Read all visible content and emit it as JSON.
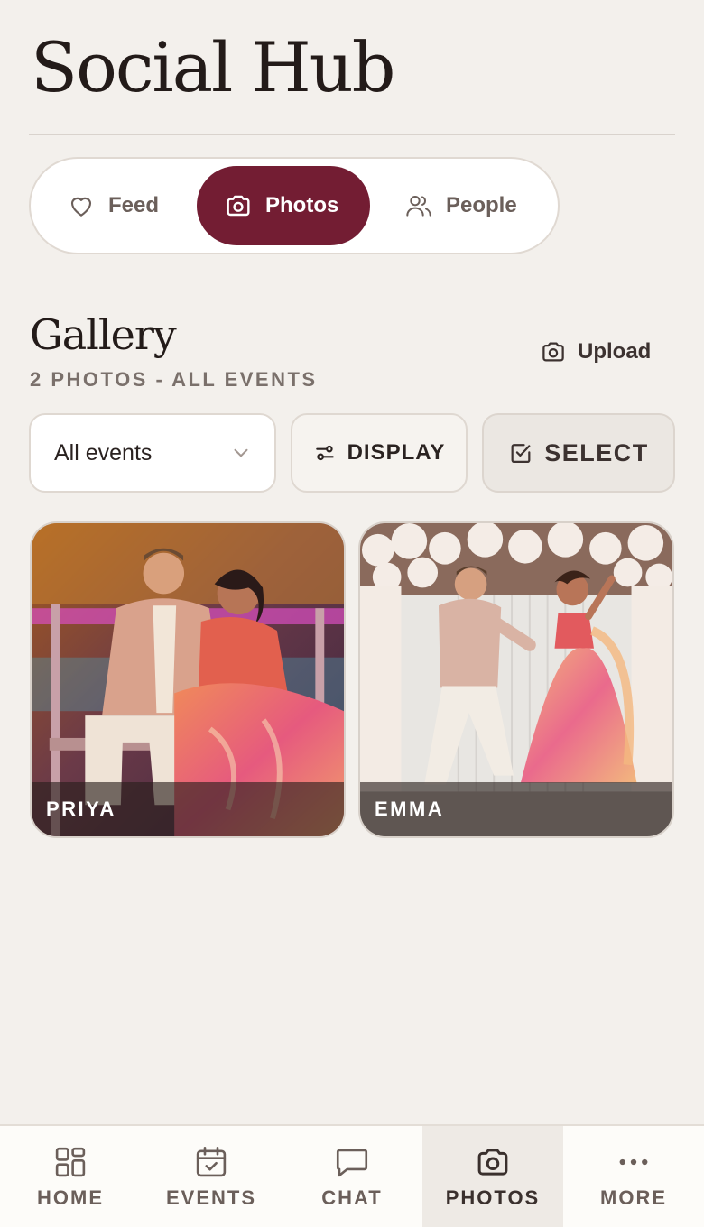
{
  "header": {
    "title": "Social Hub"
  },
  "tabs": [
    {
      "label": "Feed",
      "icon": "heart-icon",
      "active": false
    },
    {
      "label": "Photos",
      "icon": "camera-icon",
      "active": true
    },
    {
      "label": "People",
      "icon": "people-icon",
      "active": false
    }
  ],
  "gallery": {
    "title": "Gallery",
    "subtitle": "2 PHOTOS - ALL EVENTS",
    "upload_label": "Upload",
    "filter": {
      "selected": "All events"
    },
    "display_label": "DISPLAY",
    "select_label": "SELECT",
    "photos": [
      {
        "caption": "PRIYA"
      },
      {
        "caption": "EMMA"
      }
    ]
  },
  "nav": {
    "items": [
      {
        "label": "HOME",
        "icon": "grid-icon",
        "active": false
      },
      {
        "label": "EVENTS",
        "icon": "calendar-check-icon",
        "active": false
      },
      {
        "label": "CHAT",
        "icon": "chat-bubble-icon",
        "active": false
      },
      {
        "label": "PHOTOS",
        "icon": "camera-icon",
        "active": true
      },
      {
        "label": "MORE",
        "icon": "more-dots-icon",
        "active": false
      }
    ]
  },
  "colors": {
    "accent": "#731d33",
    "background": "#f3f0ec",
    "surface": "#ffffff"
  }
}
